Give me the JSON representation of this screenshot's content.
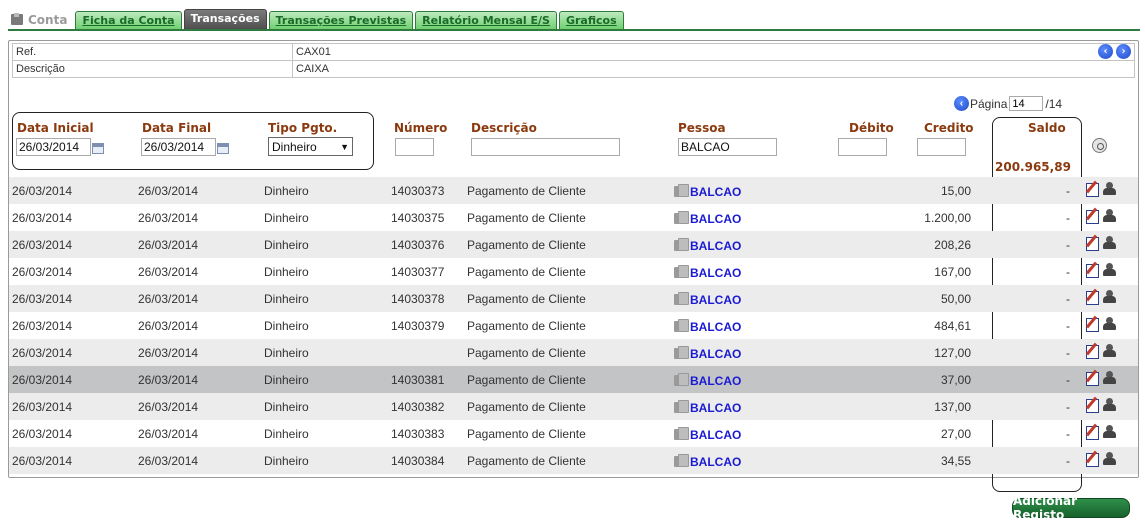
{
  "tabs": {
    "conta": "Conta",
    "items": [
      {
        "label": "Ficha da Conta"
      },
      {
        "label": "Transações"
      },
      {
        "label": "Transações Previstas"
      },
      {
        "label": "Relatório Mensal E/S"
      },
      {
        "label": "Graficos"
      }
    ]
  },
  "info": {
    "ref_label": "Ref.",
    "ref_value": "CAX01",
    "desc_label": "Descrição",
    "desc_value": "CAIXA"
  },
  "pagination": {
    "label": "Página",
    "current": "14",
    "total": "/14"
  },
  "headers": {
    "data_inicial": "Data Inicial",
    "data_final": "Data Final",
    "tipo_pgto": "Tipo Pgto.",
    "numero": "Número",
    "descricao": "Descrição",
    "pessoa": "Pessoa",
    "debito": "Débito",
    "credito": "Credito",
    "saldo": "Saldo"
  },
  "filters": {
    "data_inicial": "26/03/2014",
    "data_final": "26/03/2014",
    "tipo_pgto": "Dinheiro",
    "numero": "",
    "descricao": "",
    "pessoa": "BALCAO",
    "debito": "",
    "credito": ""
  },
  "saldo_total": "200.965,89",
  "rows": [
    {
      "di": "26/03/2014",
      "df": "26/03/2014",
      "tp": "Dinheiro",
      "nm": "14030373",
      "ds": "Pagamento de Cliente",
      "ps": "BALCAO",
      "cr": "15,00",
      "sd": "-"
    },
    {
      "di": "26/03/2014",
      "df": "26/03/2014",
      "tp": "Dinheiro",
      "nm": "14030375",
      "ds": "Pagamento de Cliente",
      "ps": "BALCAO",
      "cr": "1.200,00",
      "sd": "-"
    },
    {
      "di": "26/03/2014",
      "df": "26/03/2014",
      "tp": "Dinheiro",
      "nm": "14030376",
      "ds": "Pagamento de Cliente",
      "ps": "BALCAO",
      "cr": "208,26",
      "sd": "-"
    },
    {
      "di": "26/03/2014",
      "df": "26/03/2014",
      "tp": "Dinheiro",
      "nm": "14030377",
      "ds": "Pagamento de Cliente",
      "ps": "BALCAO",
      "cr": "167,00",
      "sd": "-"
    },
    {
      "di": "26/03/2014",
      "df": "26/03/2014",
      "tp": "Dinheiro",
      "nm": "14030378",
      "ds": "Pagamento de Cliente",
      "ps": "BALCAO",
      "cr": "50,00",
      "sd": "-"
    },
    {
      "di": "26/03/2014",
      "df": "26/03/2014",
      "tp": "Dinheiro",
      "nm": "14030379",
      "ds": "Pagamento de Cliente",
      "ps": "BALCAO",
      "cr": "484,61",
      "sd": "-"
    },
    {
      "di": "26/03/2014",
      "df": "26/03/2014",
      "tp": "Dinheiro",
      "nm": "",
      "ds": "Pagamento de Cliente",
      "ps": "BALCAO",
      "cr": "127,00",
      "sd": "-"
    },
    {
      "di": "26/03/2014",
      "df": "26/03/2014",
      "tp": "Dinheiro",
      "nm": "14030381",
      "ds": "Pagamento de Cliente",
      "ps": "BALCAO",
      "cr": "37,00",
      "sd": "-"
    },
    {
      "di": "26/03/2014",
      "df": "26/03/2014",
      "tp": "Dinheiro",
      "nm": "14030382",
      "ds": "Pagamento de Cliente",
      "ps": "BALCAO",
      "cr": "137,00",
      "sd": "-"
    },
    {
      "di": "26/03/2014",
      "df": "26/03/2014",
      "tp": "Dinheiro",
      "nm": "14030383",
      "ds": "Pagamento de Cliente",
      "ps": "BALCAO",
      "cr": "27,00",
      "sd": "-"
    },
    {
      "di": "26/03/2014",
      "df": "26/03/2014",
      "tp": "Dinheiro",
      "nm": "14030384",
      "ds": "Pagamento de Cliente",
      "ps": "BALCAO",
      "cr": "34,55",
      "sd": "-"
    }
  ],
  "actions": {
    "add": "Adicionar Registo"
  },
  "colors": {
    "accent_green": "#2f7b3d",
    "header_brown": "#8b3a0f",
    "link_blue": "#1a1ad4"
  }
}
